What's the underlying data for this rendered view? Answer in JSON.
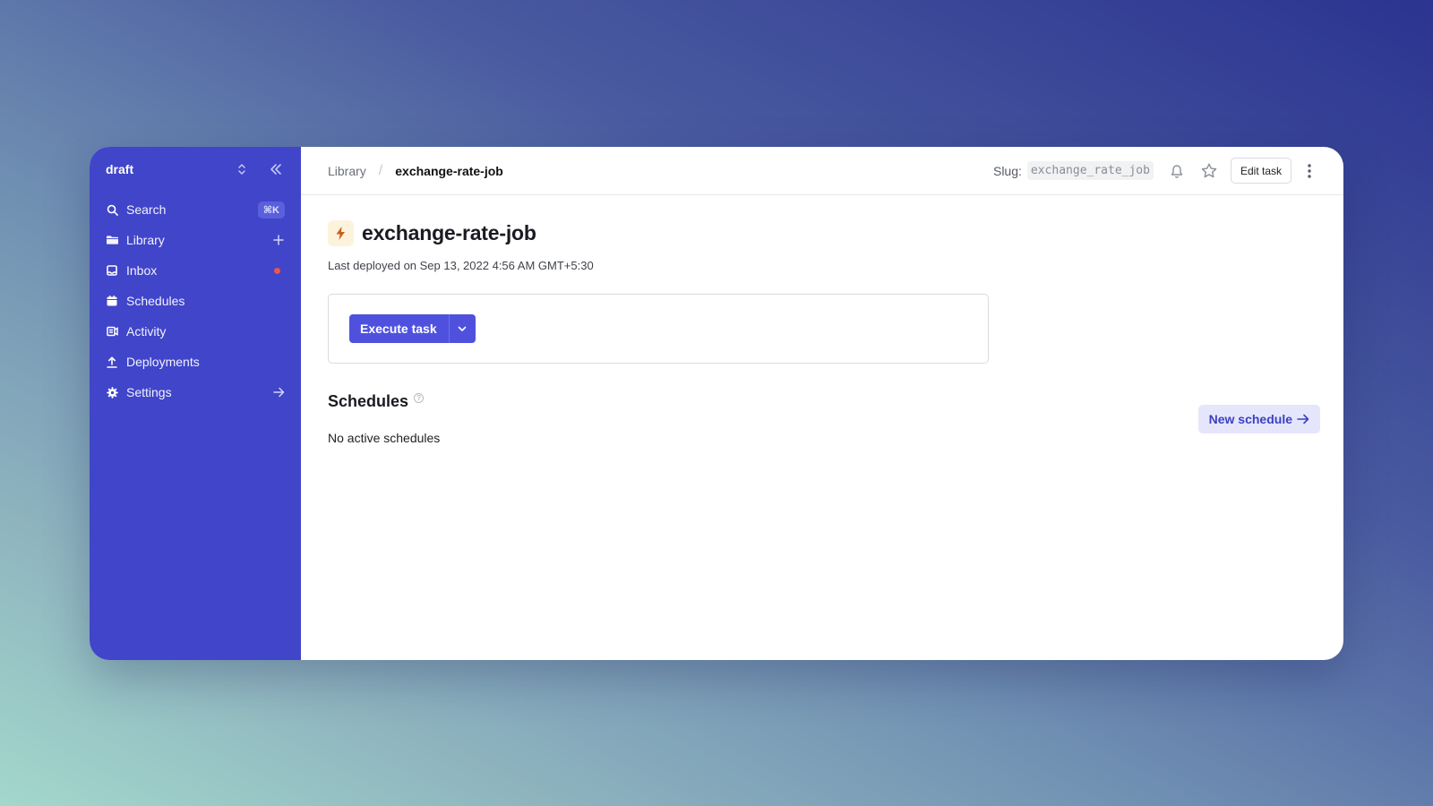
{
  "sidebar": {
    "workspace": "draft",
    "items": [
      {
        "label": "Search",
        "icon": "search-icon",
        "badge": "⌘K"
      },
      {
        "label": "Library",
        "icon": "folder-icon"
      },
      {
        "label": "Inbox",
        "icon": "inbox-icon"
      },
      {
        "label": "Schedules",
        "icon": "calendar-icon"
      },
      {
        "label": "Activity",
        "icon": "activity-icon"
      },
      {
        "label": "Deployments",
        "icon": "upload-icon"
      },
      {
        "label": "Settings",
        "icon": "gear-icon"
      }
    ],
    "accent": "#4045c9"
  },
  "header": {
    "breadcrumb_root": "Library",
    "breadcrumb_sep": "/",
    "breadcrumb_current": "exchange-rate-job",
    "slug_label": "Slug:",
    "slug_value": "exchange_rate_job",
    "edit_label": "Edit task"
  },
  "task": {
    "title": "exchange-rate-job",
    "deployed": "Last deployed on Sep 13, 2022 4:56 AM GMT+5:30",
    "execute_label": "Execute task"
  },
  "schedules": {
    "title": "Schedules",
    "help": "?",
    "new_label": "New schedule",
    "empty": "No active schedules"
  }
}
